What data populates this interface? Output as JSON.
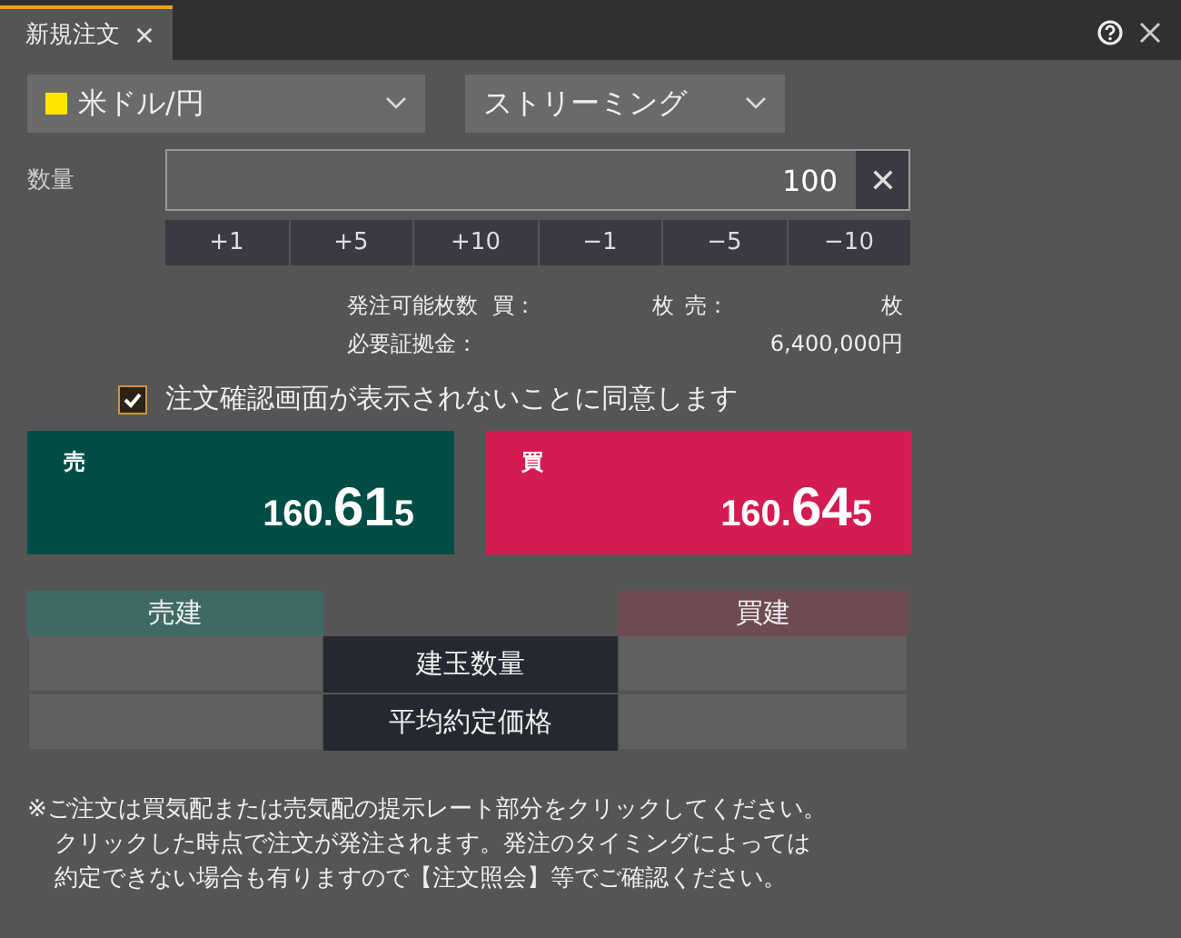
{
  "tabs": [
    {
      "label": "新規注文",
      "selected": true
    }
  ],
  "pair_select": {
    "value": "米ドル/円",
    "color": "#ffe600"
  },
  "mode_select": {
    "value": "ストリーミング"
  },
  "quantity": {
    "label": "数量",
    "value": "100"
  },
  "steps": [
    "+1",
    "+5",
    "+10",
    "−1",
    "−5",
    "−10"
  ],
  "available": {
    "label": "発注可能枚数",
    "buy_label": "買：",
    "buy_unit": "枚",
    "sell_label": "売：",
    "sell_unit": "枚"
  },
  "margin": {
    "label": "必要証拠金：",
    "value": "6,400,000円"
  },
  "skip_confirm": {
    "label": "注文確認画面が表示されないことに同意します",
    "checked": true
  },
  "quotes": [
    {
      "kind": "sell",
      "label": "売",
      "head": "160.",
      "big": "61",
      "tail": "5"
    },
    {
      "kind": "buy",
      "label": "買",
      "head": "160.",
      "big": "64",
      "tail": "5"
    }
  ],
  "positions": {
    "sell_header": "売建",
    "buy_header": "買建",
    "rows": [
      "建玉数量",
      "平均約定価格"
    ]
  },
  "notes": [
    "※ご注文は買気配または売気配の提示レート部分をクリックしてください。",
    "クリックした時点で注文が発注されます。発注のタイミングによっては",
    "約定できない場合も有りますので【注文照会】等でご確認ください。"
  ]
}
